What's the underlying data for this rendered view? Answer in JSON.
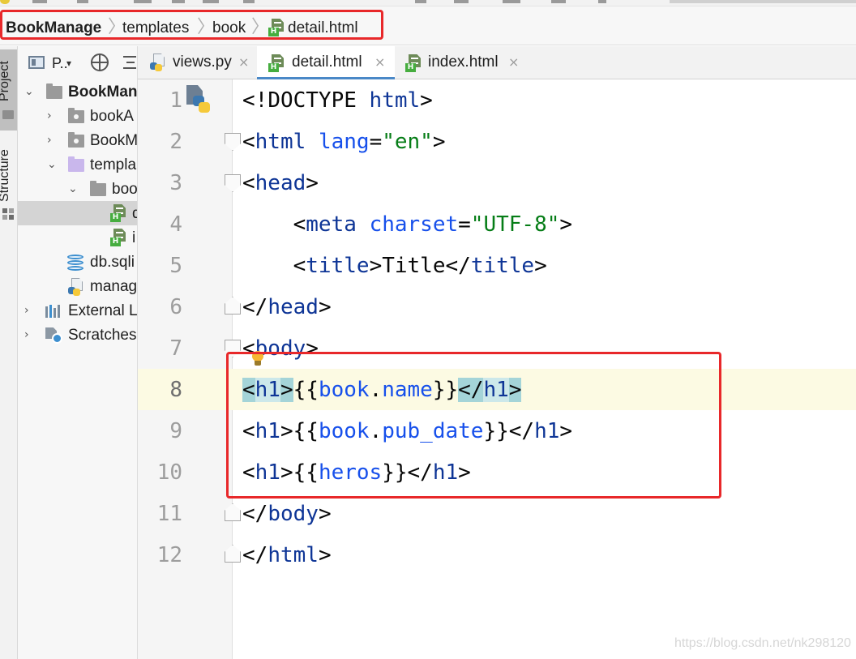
{
  "breadcrumb": {
    "items": [
      "BookManage",
      "templates",
      "book",
      "detail.html"
    ]
  },
  "sidebar": {
    "labels": {
      "project": "Project",
      "structure": "Structure"
    }
  },
  "project_panel": {
    "title": "P..",
    "items": [
      {
        "label": "BookMan",
        "icon": "folder-icon",
        "expanded": true
      },
      {
        "label": "bookA",
        "icon": "folder-icon",
        "expanded": false
      },
      {
        "label": "BookM",
        "icon": "folder-icon",
        "expanded": false
      },
      {
        "label": "templa",
        "icon": "folder-purple-icon",
        "expanded": true
      },
      {
        "label": "boo",
        "icon": "folder-icon",
        "expanded": true
      },
      {
        "label": "d",
        "icon": "html-file-icon",
        "selected": true
      },
      {
        "label": "i",
        "icon": "html-file-icon"
      },
      {
        "label": "db.sqli",
        "icon": "database-icon"
      },
      {
        "label": "manag",
        "icon": "python-file-icon"
      },
      {
        "label": "External Li",
        "icon": "library-icon",
        "expanded": false
      },
      {
        "label": "Scratches",
        "icon": "scratches-icon",
        "expanded": false
      }
    ]
  },
  "editor": {
    "tabs": [
      {
        "label": "views.py",
        "icon": "python-file-icon",
        "active": false
      },
      {
        "label": "detail.html",
        "icon": "html-file-icon",
        "active": true
      },
      {
        "label": "index.html",
        "icon": "html-file-icon",
        "active": false
      }
    ],
    "close_glyph": "×",
    "current_line": 8,
    "lines": [
      {
        "no": "1",
        "text": "<!DOCTYPE html>"
      },
      {
        "no": "2",
        "text": "<html lang=\"en\">"
      },
      {
        "no": "3",
        "text": "<head>"
      },
      {
        "no": "4",
        "text": "    <meta charset=\"UTF-8\">"
      },
      {
        "no": "5",
        "text": "    <title>Title</title>"
      },
      {
        "no": "6",
        "text": "</head>"
      },
      {
        "no": "7",
        "text": "<body>"
      },
      {
        "no": "8",
        "text": "<h1>{{book.name}}</h1>"
      },
      {
        "no": "9",
        "text": "<h1>{{book.pub_date}}</h1>"
      },
      {
        "no": "10",
        "text": "<h1>{{heros}}</h1>"
      },
      {
        "no": "11",
        "text": "</body>"
      },
      {
        "no": "12",
        "text": "</html>"
      }
    ]
  },
  "colors": {
    "tag": "#0e3596",
    "attribute": "#1750eb",
    "string": "#067d17",
    "annotation_red": "#e8282a",
    "active_tab_underline": "#4a88c7",
    "bracket_highlight": "#a4d4d8"
  },
  "watermark": "https://blog.csdn.net/nk298120"
}
